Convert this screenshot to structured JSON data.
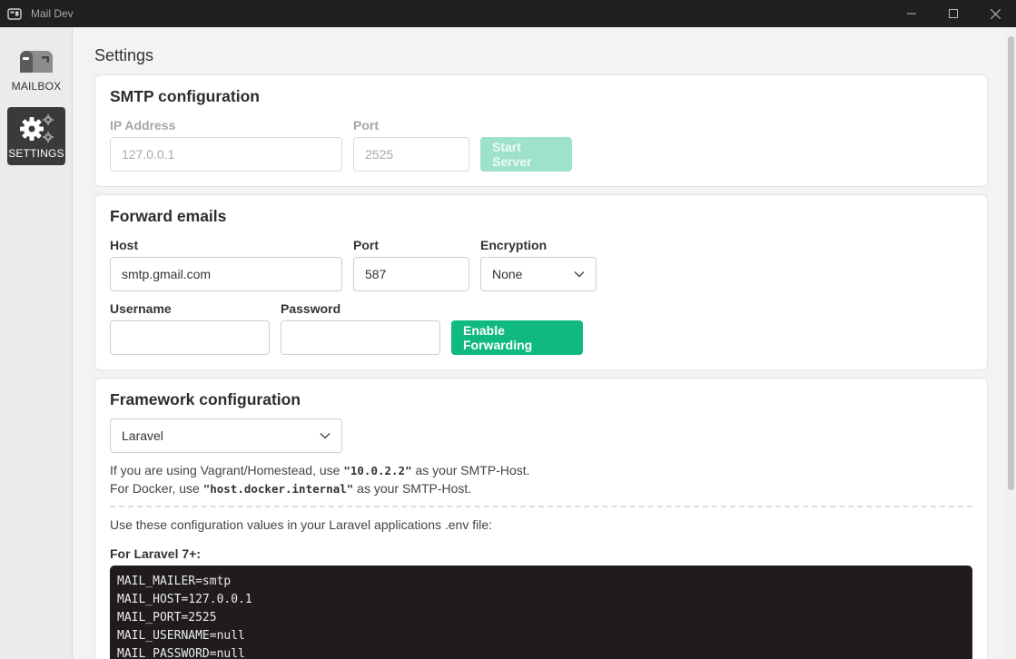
{
  "window": {
    "title": "Mail Dev"
  },
  "sidebar": {
    "items": [
      {
        "label": "MAILBOX",
        "icon": "mailbox-icon"
      },
      {
        "label": "SETTINGS",
        "icon": "gears-icon"
      }
    ]
  },
  "main": {
    "title": "Settings"
  },
  "smtp": {
    "heading": "SMTP configuration",
    "ip_label": "IP Address",
    "ip_value": "127.0.0.1",
    "port_label": "Port",
    "port_value": "2525",
    "start_label": "Start Server"
  },
  "forward": {
    "heading": "Forward emails",
    "host_label": "Host",
    "host_value": "smtp.gmail.com",
    "port_label": "Port",
    "port_value": "587",
    "encryption_label": "Encryption",
    "encryption_value": "None",
    "username_label": "Username",
    "username_value": "",
    "password_label": "Password",
    "password_value": "",
    "enable_label": "Enable Forwarding"
  },
  "framework": {
    "heading": "Framework configuration",
    "selected": "Laravel",
    "hint1_prefix": "If you are using Vagrant/Homestead, use ",
    "hint1_code": "\"10.0.2.2\"",
    "hint1_suffix": " as your SMTP-Host.",
    "hint2_prefix": "For Docker, use ",
    "hint2_code": "\"host.docker.internal\"",
    "hint2_suffix": " as your SMTP-Host.",
    "env_note": "Use these configuration values in your Laravel applications .env file:",
    "version_label": "For Laravel 7+:",
    "code_lines": [
      "MAIL_MAILER=smtp",
      "MAIL_HOST=127.0.0.1",
      "MAIL_PORT=2525",
      "MAIL_USERNAME=null",
      "MAIL_PASSWORD=null"
    ]
  },
  "colors": {
    "accent": "#10b981",
    "accent_disabled": "#9fe2cc",
    "sidebar_active": "#3a3a3a",
    "titlebar": "#202020"
  }
}
